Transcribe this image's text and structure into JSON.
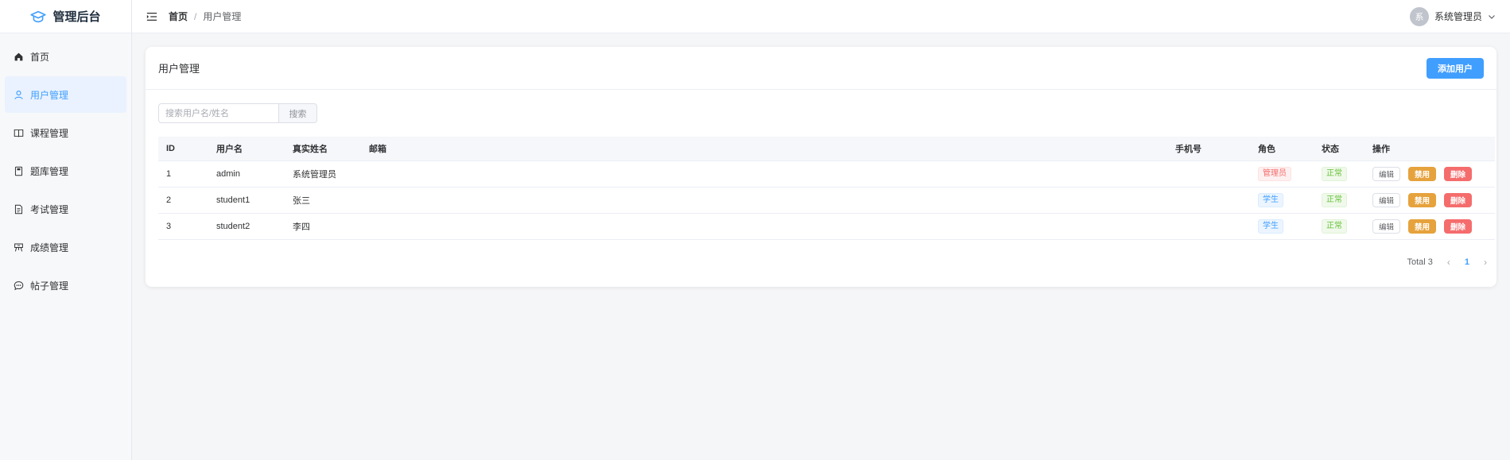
{
  "app": {
    "title": "管理后台"
  },
  "sidebar": {
    "items": [
      {
        "label": "首页",
        "icon": "home-icon"
      },
      {
        "label": "用户管理",
        "icon": "user-icon",
        "active": true
      },
      {
        "label": "课程管理",
        "icon": "book-icon"
      },
      {
        "label": "题库管理",
        "icon": "notebook-icon"
      },
      {
        "label": "考试管理",
        "icon": "document-icon"
      },
      {
        "label": "成绩管理",
        "icon": "trophy-icon"
      },
      {
        "label": "帖子管理",
        "icon": "chat-icon"
      }
    ]
  },
  "header": {
    "breadcrumb": {
      "home": "首页",
      "separator": "/",
      "current": "用户管理"
    },
    "user": {
      "avatar_text": "系",
      "name": "系统管理员"
    }
  },
  "main": {
    "title": "用户管理",
    "add_button": "添加用户",
    "search": {
      "placeholder": "搜索用户名/姓名",
      "button": "搜索"
    },
    "table": {
      "columns": [
        "ID",
        "用户名",
        "真实姓名",
        "邮箱",
        "手机号",
        "角色",
        "状态",
        "操作"
      ],
      "rows": [
        {
          "id": "1",
          "username": "admin",
          "realname": "系统管理员",
          "email": "",
          "phone": "",
          "role": "管理员",
          "status": "正常"
        },
        {
          "id": "2",
          "username": "student1",
          "realname": "张三",
          "email": "",
          "phone": "",
          "role": "学生",
          "status": "正常"
        },
        {
          "id": "3",
          "username": "student2",
          "realname": "李四",
          "email": "",
          "phone": "",
          "role": "学生",
          "status": "正常"
        }
      ],
      "actions": {
        "edit": "编辑",
        "disable": "禁用",
        "delete": "删除"
      }
    },
    "pagination": {
      "total": "Total 3",
      "current": "1"
    }
  },
  "colors": {
    "primary": "#409eff",
    "warning": "#e6a23c",
    "danger": "#f56c6c",
    "success": "#67c23a"
  }
}
